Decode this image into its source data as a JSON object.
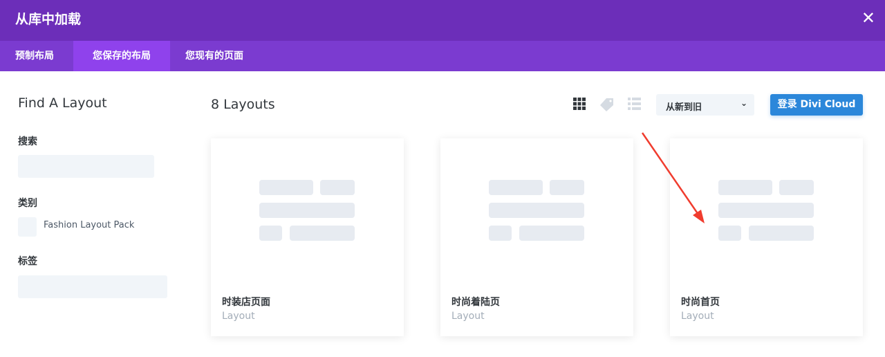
{
  "header": {
    "title": "从库中加载",
    "close_icon": "close-icon"
  },
  "tabs": [
    {
      "label": "预制布局",
      "active": false
    },
    {
      "label": "您保存的布局",
      "active": true
    },
    {
      "label": "您现有的页面",
      "active": false
    }
  ],
  "sidebar": {
    "title": "Find A Layout",
    "search_label": "搜索",
    "search_value": "",
    "category_label": "类别",
    "categories": [
      {
        "label": "Fashion Layout Pack",
        "checked": false
      }
    ],
    "tags_label": "标签",
    "tags_value": ""
  },
  "main": {
    "count": "8 Layouts",
    "view_icons": [
      "grid-icon",
      "tag-icon",
      "list-icon"
    ],
    "sort": "从新到旧",
    "login_button": "登录 Divi Cloud",
    "cards": [
      {
        "title": "时装店页面",
        "type": "Layout"
      },
      {
        "title": "时尚着陆页",
        "type": "Layout"
      },
      {
        "title": "时尚首页",
        "type": "Layout"
      }
    ]
  },
  "colors": {
    "header": "#6c2eb9",
    "tabbar": "#7b3bd0",
    "active_tab": "#8f42ec",
    "button": "#2b87da",
    "arrow": "#f03c2e"
  }
}
